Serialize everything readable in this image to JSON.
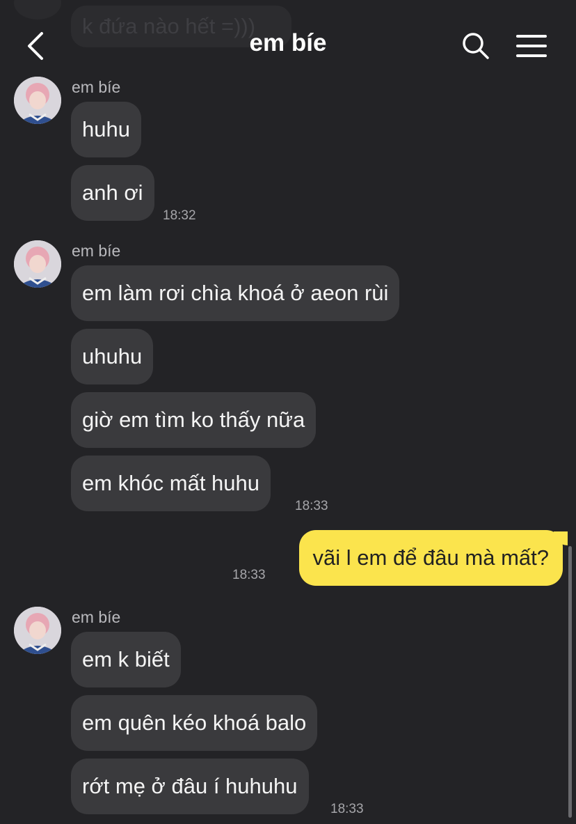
{
  "previous_message": "k đứa nào hết =)))",
  "header": {
    "title": "em bíe"
  },
  "groups": [
    {
      "sender": "em bíe",
      "messages": [
        "huhu",
        "anh ơi"
      ],
      "time": "18:32"
    },
    {
      "sender": "em bíe",
      "messages": [
        "em làm rơi chìa khoá ở aeon rùi",
        "uhuhu",
        "giờ em tìm ko thấy nữa",
        "em khóc mất huhu"
      ],
      "time": "18:33"
    },
    {
      "mine": true,
      "messages": [
        "vãi l em để đâu mà mất?"
      ],
      "time": "18:33"
    },
    {
      "sender": "em bíe",
      "messages": [
        "em k biết",
        "em quên kéo khoá balo",
        "rớt mẹ ở đâu í huhuhu"
      ],
      "time": "18:33"
    }
  ],
  "colors": {
    "background": "#232326",
    "incoming_bubble": "#3a3a3d",
    "outgoing_bubble": "#fbe44d"
  },
  "icons": [
    "back-icon",
    "search-icon",
    "menu-icon"
  ]
}
